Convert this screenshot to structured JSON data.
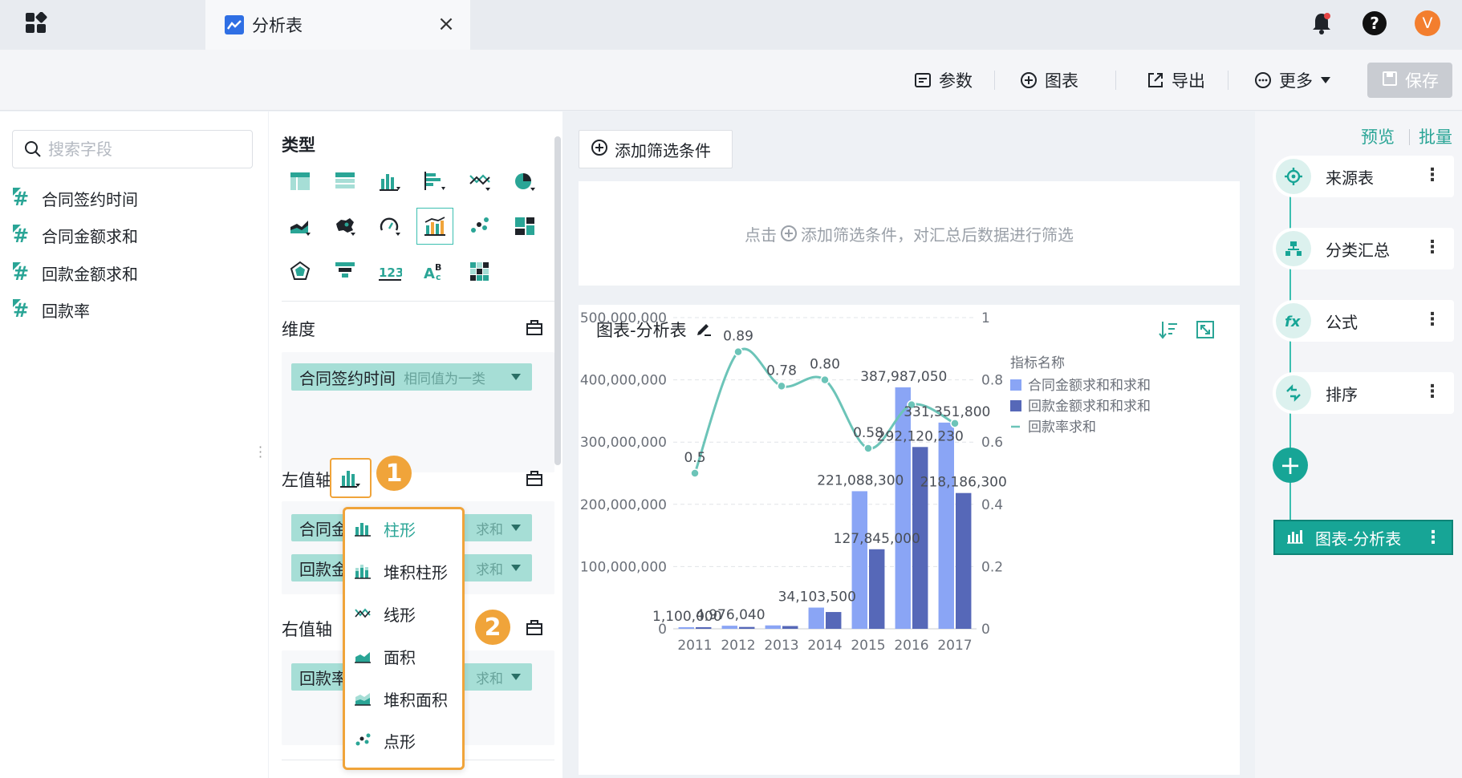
{
  "topbar": {
    "tab_label": "分析表",
    "avatar_letter": "V"
  },
  "toolbar": {
    "params_label": "参数",
    "chart_label": "图表",
    "export_label": "导出",
    "more_label": "更多",
    "save_label": "保存"
  },
  "fields": {
    "search_placeholder": "搜索字段",
    "items": [
      {
        "label": "合同签约时间"
      },
      {
        "label": "合同金额求和"
      },
      {
        "label": "回款金额求和"
      },
      {
        "label": "回款率"
      }
    ]
  },
  "config": {
    "type_title": "类型",
    "dimension_title": "维度",
    "dimension_pill": {
      "label": "合同签约时间",
      "sub": "相同值为一类"
    },
    "left_axis_title": "左值轴",
    "left_pills": [
      {
        "label": "合同金",
        "sub": "求和"
      },
      {
        "label": "回款金",
        "sub": "求和"
      }
    ],
    "right_axis_title": "右值轴",
    "right_pills": [
      {
        "label": "回款率",
        "sub": "求和"
      }
    ],
    "badge_1": "1",
    "badge_2": "2",
    "menu": [
      {
        "label": "柱形",
        "icon": "bar-chart-icon",
        "active": true
      },
      {
        "label": "堆积柱形",
        "icon": "stacked-bar-icon"
      },
      {
        "label": "线形",
        "icon": "line-chart-icon"
      },
      {
        "label": "面积",
        "icon": "area-chart-icon"
      },
      {
        "label": "堆积面积",
        "icon": "stacked-area-icon"
      },
      {
        "label": "点形",
        "icon": "scatter-chart-icon"
      }
    ]
  },
  "main": {
    "add_filter_label": "添加筛选条件",
    "filter_hint_prefix": "点击",
    "filter_hint_suffix": "添加筛选条件，对汇总后数据进行筛选",
    "chart_title": "图表-分析表"
  },
  "flow": {
    "preview_label": "预览",
    "batch_label": "批量",
    "nodes": [
      {
        "label": "来源表",
        "icon": "crosshair-icon"
      },
      {
        "label": "分类汇总",
        "icon": "hierarchy-icon"
      },
      {
        "label": "公式",
        "icon": "fx-icon"
      },
      {
        "label": "排序",
        "icon": "sort-arrows-icon"
      }
    ],
    "active_node_label": "图表-分析表"
  },
  "colors": {
    "accent": "#17a596",
    "series1": "#8aa5f5",
    "series2": "#5668b8",
    "series3": "#6cc4b8",
    "badge": "#f0a43a"
  },
  "chart_data": {
    "type": "bar",
    "categories": [
      "2011",
      "2012",
      "2013",
      "2014",
      "2015",
      "2016",
      "2017"
    ],
    "legend_title": "指标名称",
    "legend_position": "right",
    "series": [
      {
        "name": "合同金额求和和求和",
        "axis": "left",
        "type": "bar",
        "values": [
          1100000,
          4976040,
          5500000,
          34103500,
          221088300,
          387987050,
          331351800
        ],
        "labels": [
          "1,100,000",
          "4,976,040",
          "",
          "34,103,500",
          "221,088,300",
          "387,987,050",
          "331,351,800"
        ]
      },
      {
        "name": "回款金额求和和求和",
        "axis": "left",
        "type": "bar",
        "values": [
          800000,
          3000000,
          4500000,
          27000000,
          127845000,
          292120230,
          218186300
        ],
        "labels": [
          "",
          "",
          "",
          "",
          "127,845,000",
          "292,120,230",
          "218,186,300"
        ]
      },
      {
        "name": "回款率求和",
        "axis": "right",
        "type": "line",
        "values": [
          0.5,
          0.89,
          0.78,
          0.8,
          0.58,
          0.72,
          0.66
        ],
        "labels": [
          "0.5",
          "0.89",
          "0.78",
          "0.80",
          "0.58",
          "",
          ""
        ]
      }
    ],
    "y_left": {
      "min": 0,
      "max": 500000000,
      "ticks": [
        "0",
        "100,000,000",
        "200,000,000",
        "300,000,000",
        "400,000,000",
        "500,000,000"
      ]
    },
    "y_right": {
      "min": 0,
      "max": 1,
      "ticks": [
        "0",
        "0.2",
        "0.4",
        "0.6",
        "0.8",
        "1"
      ]
    },
    "grid": true
  }
}
